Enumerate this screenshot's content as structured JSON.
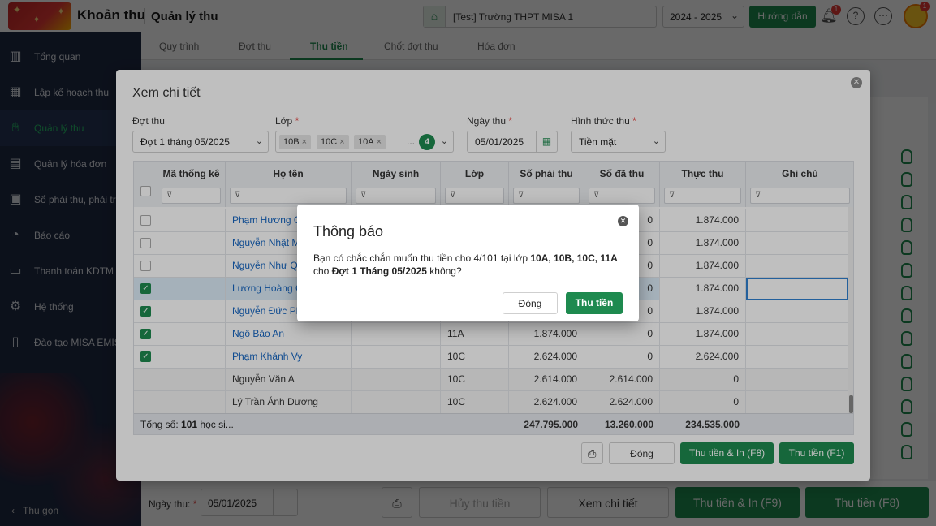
{
  "header": {
    "app_title": "Khoản thu",
    "module_title": "Quản lý thu",
    "school": "[Test] Trường THPT MISA 1",
    "year": "2024 - 2025",
    "guide_button": "Hướng dẫn",
    "notification_count": "1",
    "avatar_badge": "1"
  },
  "sidebar": {
    "items": [
      {
        "label": "Tổng quan",
        "icon": "chart-icon"
      },
      {
        "label": "Lập kế hoạch thu",
        "icon": "calendar-money-icon"
      },
      {
        "label": "Quản lý thu",
        "icon": "hand-coin-icon"
      },
      {
        "label": "Quản lý hóa đơn",
        "icon": "invoice-icon"
      },
      {
        "label": "Sổ phải thu, phải trả",
        "icon": "ledger-icon"
      },
      {
        "label": "Báo cáo",
        "icon": "pie-icon"
      },
      {
        "label": "Thanh toán KDTM",
        "icon": "card-icon"
      },
      {
        "label": "Hệ thống",
        "icon": "gear-icon"
      },
      {
        "label": "Đào tạo MISA EMIS",
        "icon": "book-icon"
      }
    ],
    "collapse_label": "Thu gọn"
  },
  "main_tabs": [
    "Quy trình",
    "Đợt thu",
    "Thu tiền",
    "Chốt đợt thu",
    "Hóa đơn"
  ],
  "bottom_bar": {
    "date_label": "Ngày thu:",
    "date_value": "05/01/2025",
    "cancel_button": "Hủy thu tiền",
    "detail_button": "Xem chi tiết",
    "collect_print_button": "Thu tiền & In (F9)",
    "collect_button": "Thu tiền (F8)"
  },
  "detail_dialog": {
    "title": "Xem chi tiết",
    "fields": {
      "period_label": "Đợt thu",
      "period_value": "Đợt 1 tháng 05/2025",
      "class_label": "Lớp",
      "class_tags": [
        "10B",
        "10C",
        "10A"
      ],
      "class_more": "...",
      "class_count": "4",
      "date_label": "Ngày thu",
      "date_value": "05/01/2025",
      "method_label": "Hình thức thu",
      "method_value": "Tiền mặt"
    },
    "columns": [
      "Mã thống kê",
      "Họ tên",
      "Ngày sinh",
      "Lớp",
      "Số phải thu",
      "Số đã thu",
      "Thực thu",
      "Ghi chú"
    ],
    "rows": [
      {
        "checked": false,
        "name": "Phạm Hương Giang",
        "class": "",
        "due": "",
        "paid": "0",
        "actual": "1.874.000",
        "note": ""
      },
      {
        "checked": false,
        "name": "Nguyễn Nhật Minh",
        "class": "",
        "due": "",
        "paid": "0",
        "actual": "1.874.000",
        "note": ""
      },
      {
        "checked": false,
        "name": "Nguyễn Như Quỳnh",
        "class": "",
        "due": "",
        "paid": "0",
        "actual": "1.874.000",
        "note": ""
      },
      {
        "checked": true,
        "name": "Lương Hoàng Giang",
        "class": "",
        "due": "",
        "paid": "0",
        "actual": "1.874.000",
        "note": ""
      },
      {
        "checked": true,
        "name": "Nguyễn Đức Phúc",
        "class": "",
        "due": "",
        "paid": "0",
        "actual": "1.874.000",
        "note": ""
      },
      {
        "checked": true,
        "name": "Ngô Bảo An",
        "class": "11A",
        "due": "1.874.000",
        "paid": "0",
        "actual": "1.874.000",
        "note": ""
      },
      {
        "checked": true,
        "name": "Phạm Khánh Vy",
        "class": "10C",
        "due": "2.624.000",
        "paid": "0",
        "actual": "2.624.000",
        "note": ""
      },
      {
        "checked": null,
        "name": "Nguyễn Văn A",
        "class": "10C",
        "due": "2.614.000",
        "paid": "2.614.000",
        "actual": "0",
        "note": ""
      },
      {
        "checked": null,
        "name": "Lý Trần Ánh Dương",
        "class": "10C",
        "due": "2.624.000",
        "paid": "2.624.000",
        "actual": "0",
        "note": ""
      }
    ],
    "footer": {
      "total_prefix": "Tổng số:",
      "total_count": "101",
      "total_suffix": "học si...",
      "due_total": "247.795.000",
      "paid_total": "13.260.000",
      "actual_total": "234.535.000"
    },
    "buttons": {
      "close": "Đóng",
      "collect_print": "Thu tiền & In (F8)",
      "collect": "Thu tiền (F1)"
    }
  },
  "confirm_dialog": {
    "title": "Thông báo",
    "msg_part1": "Bạn có chắc chắn muốn thu tiền cho 4/101 tại lớp ",
    "msg_classes": "10A, 10B, 10C, 11A",
    "msg_part2": " cho ",
    "msg_period": "Đợt 1 Tháng 05/2025",
    "msg_part3": " không?",
    "cancel_button": "Đóng",
    "confirm_button": "Thu tiền"
  },
  "colors": {
    "accent": "#1e8a4f",
    "sidebar": "#1f2a44",
    "link": "#1565c0"
  }
}
